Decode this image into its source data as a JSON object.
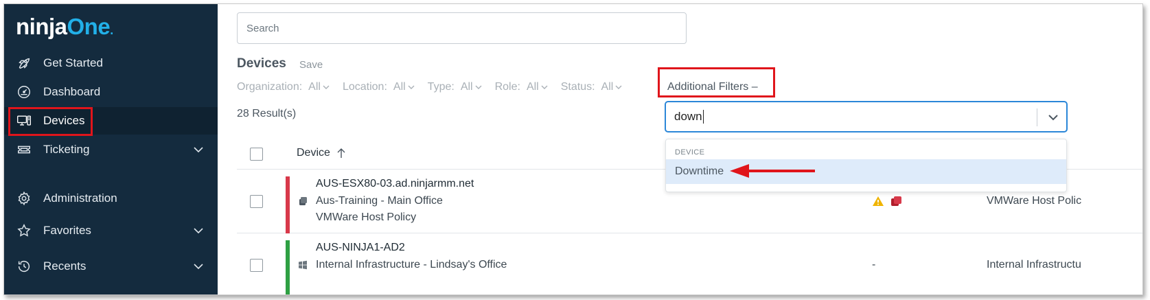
{
  "brand": {
    "logo_main": "ninja",
    "logo_accent": "One"
  },
  "sidebar": {
    "items": [
      {
        "label": "Get Started",
        "icon": "rocket-icon"
      },
      {
        "label": "Dashboard",
        "icon": "gauge-icon"
      },
      {
        "label": "Devices",
        "icon": "devices-icon",
        "active": true
      },
      {
        "label": "Ticketing",
        "icon": "ticket-icon",
        "expandable": true
      },
      {
        "label": "Administration",
        "icon": "gear-icon"
      },
      {
        "label": "Favorites",
        "icon": "star-icon",
        "expandable": true
      },
      {
        "label": "Recents",
        "icon": "history-icon",
        "expandable": true
      }
    ]
  },
  "search": {
    "placeholder": "Search"
  },
  "page": {
    "title": "Devices",
    "save_label": "Save",
    "results": "28 Result(s)"
  },
  "filters": [
    {
      "label": "Organization:",
      "value": "All"
    },
    {
      "label": "Location:",
      "value": "All"
    },
    {
      "label": "Type:",
      "value": "All"
    },
    {
      "label": "Role:",
      "value": "All"
    },
    {
      "label": "Status:",
      "value": "All"
    }
  ],
  "additional_filters": {
    "label": "Additional Filters –"
  },
  "filter_dropdown": {
    "value": "down",
    "group_label": "DEVICE",
    "option": "Downtime"
  },
  "table": {
    "header_device": "Device",
    "rows": [
      {
        "name": "AUS-ESX80-03.ad.ninjarmm.net",
        "org": "Aus-Training - Main Office",
        "policy": "VMWare Host Policy",
        "policy_col": "VMWare Host Polic",
        "status_color": "#d8394a",
        "os_icon": "server-icon"
      },
      {
        "name": "AUS-NINJA1-AD2",
        "org": "Internal Infrastructure - Lindsay's Office",
        "alert_col": "-",
        "policy_col": "Internal Infrastructu",
        "status_color": "#2ea043",
        "os_icon": "windows-icon"
      }
    ]
  },
  "colors": {
    "sidebar_bg": "#142b3e",
    "accent": "#22b0e8",
    "highlight": "#e0151b",
    "focus": "#2a86d8"
  }
}
